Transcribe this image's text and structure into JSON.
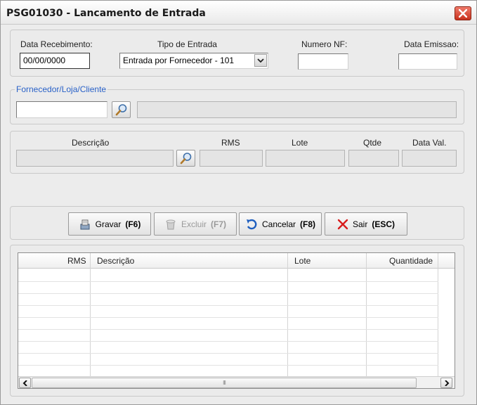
{
  "window": {
    "title": "PSG01030 - Lancamento de Entrada",
    "close_icon": "close-icon"
  },
  "header_form": {
    "data_recebimento_label": "Data Recebimento:",
    "data_recebimento_value": "00/00/0000",
    "tipo_entrada_label": "Tipo de Entrada",
    "tipo_entrada_value": "Entrada por Fornecedor - 101",
    "numero_nf_label": "Numero NF:",
    "numero_nf_value": "",
    "data_emissao_label": "Data Emissao:",
    "data_emissao_value": ""
  },
  "fornecedor": {
    "group_label": "Fornecedor/Loja/Cliente",
    "code_value": "",
    "name_value": ""
  },
  "item_form": {
    "descricao_label": "Descrição",
    "rms_label": "RMS",
    "lote_label": "Lote",
    "qtde_label": "Qtde",
    "data_val_label": "Data Val."
  },
  "actions": {
    "gravar_label": "Gravar",
    "gravar_key": "(F6)",
    "excluir_label": "Excluir",
    "excluir_key": "(F7)",
    "cancelar_label": "Cancelar",
    "cancelar_key": "(F8)",
    "sair_label": "Sair",
    "sair_key": "(ESC)"
  },
  "grid": {
    "columns": [
      "RMS",
      "Descrição",
      "Lote",
      "Quantidade"
    ],
    "rows": [],
    "scroll_thumb_grip": "III"
  },
  "colors": {
    "accent_blue": "#2a62c8",
    "close_red": "#c8321e",
    "sair_red": "#d81c1c"
  }
}
